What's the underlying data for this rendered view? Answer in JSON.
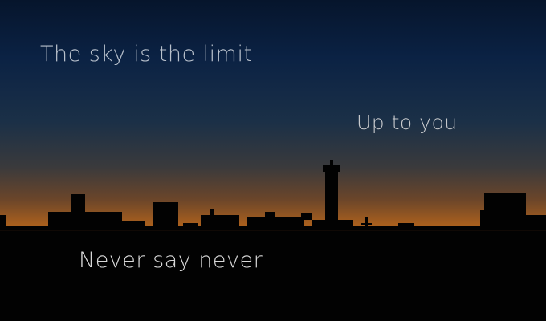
{
  "image": {
    "subject": "city-skyline-silhouette-at-dusk",
    "colors": {
      "sky_top": "#06152c",
      "sky_mid": "#1b3047",
      "horizon_glow": "#c9711c",
      "ground": "#000000"
    }
  },
  "quotes": [
    {
      "text": "The sky is the limit"
    },
    {
      "text": "Up to you"
    },
    {
      "text": "Never say never"
    }
  ]
}
